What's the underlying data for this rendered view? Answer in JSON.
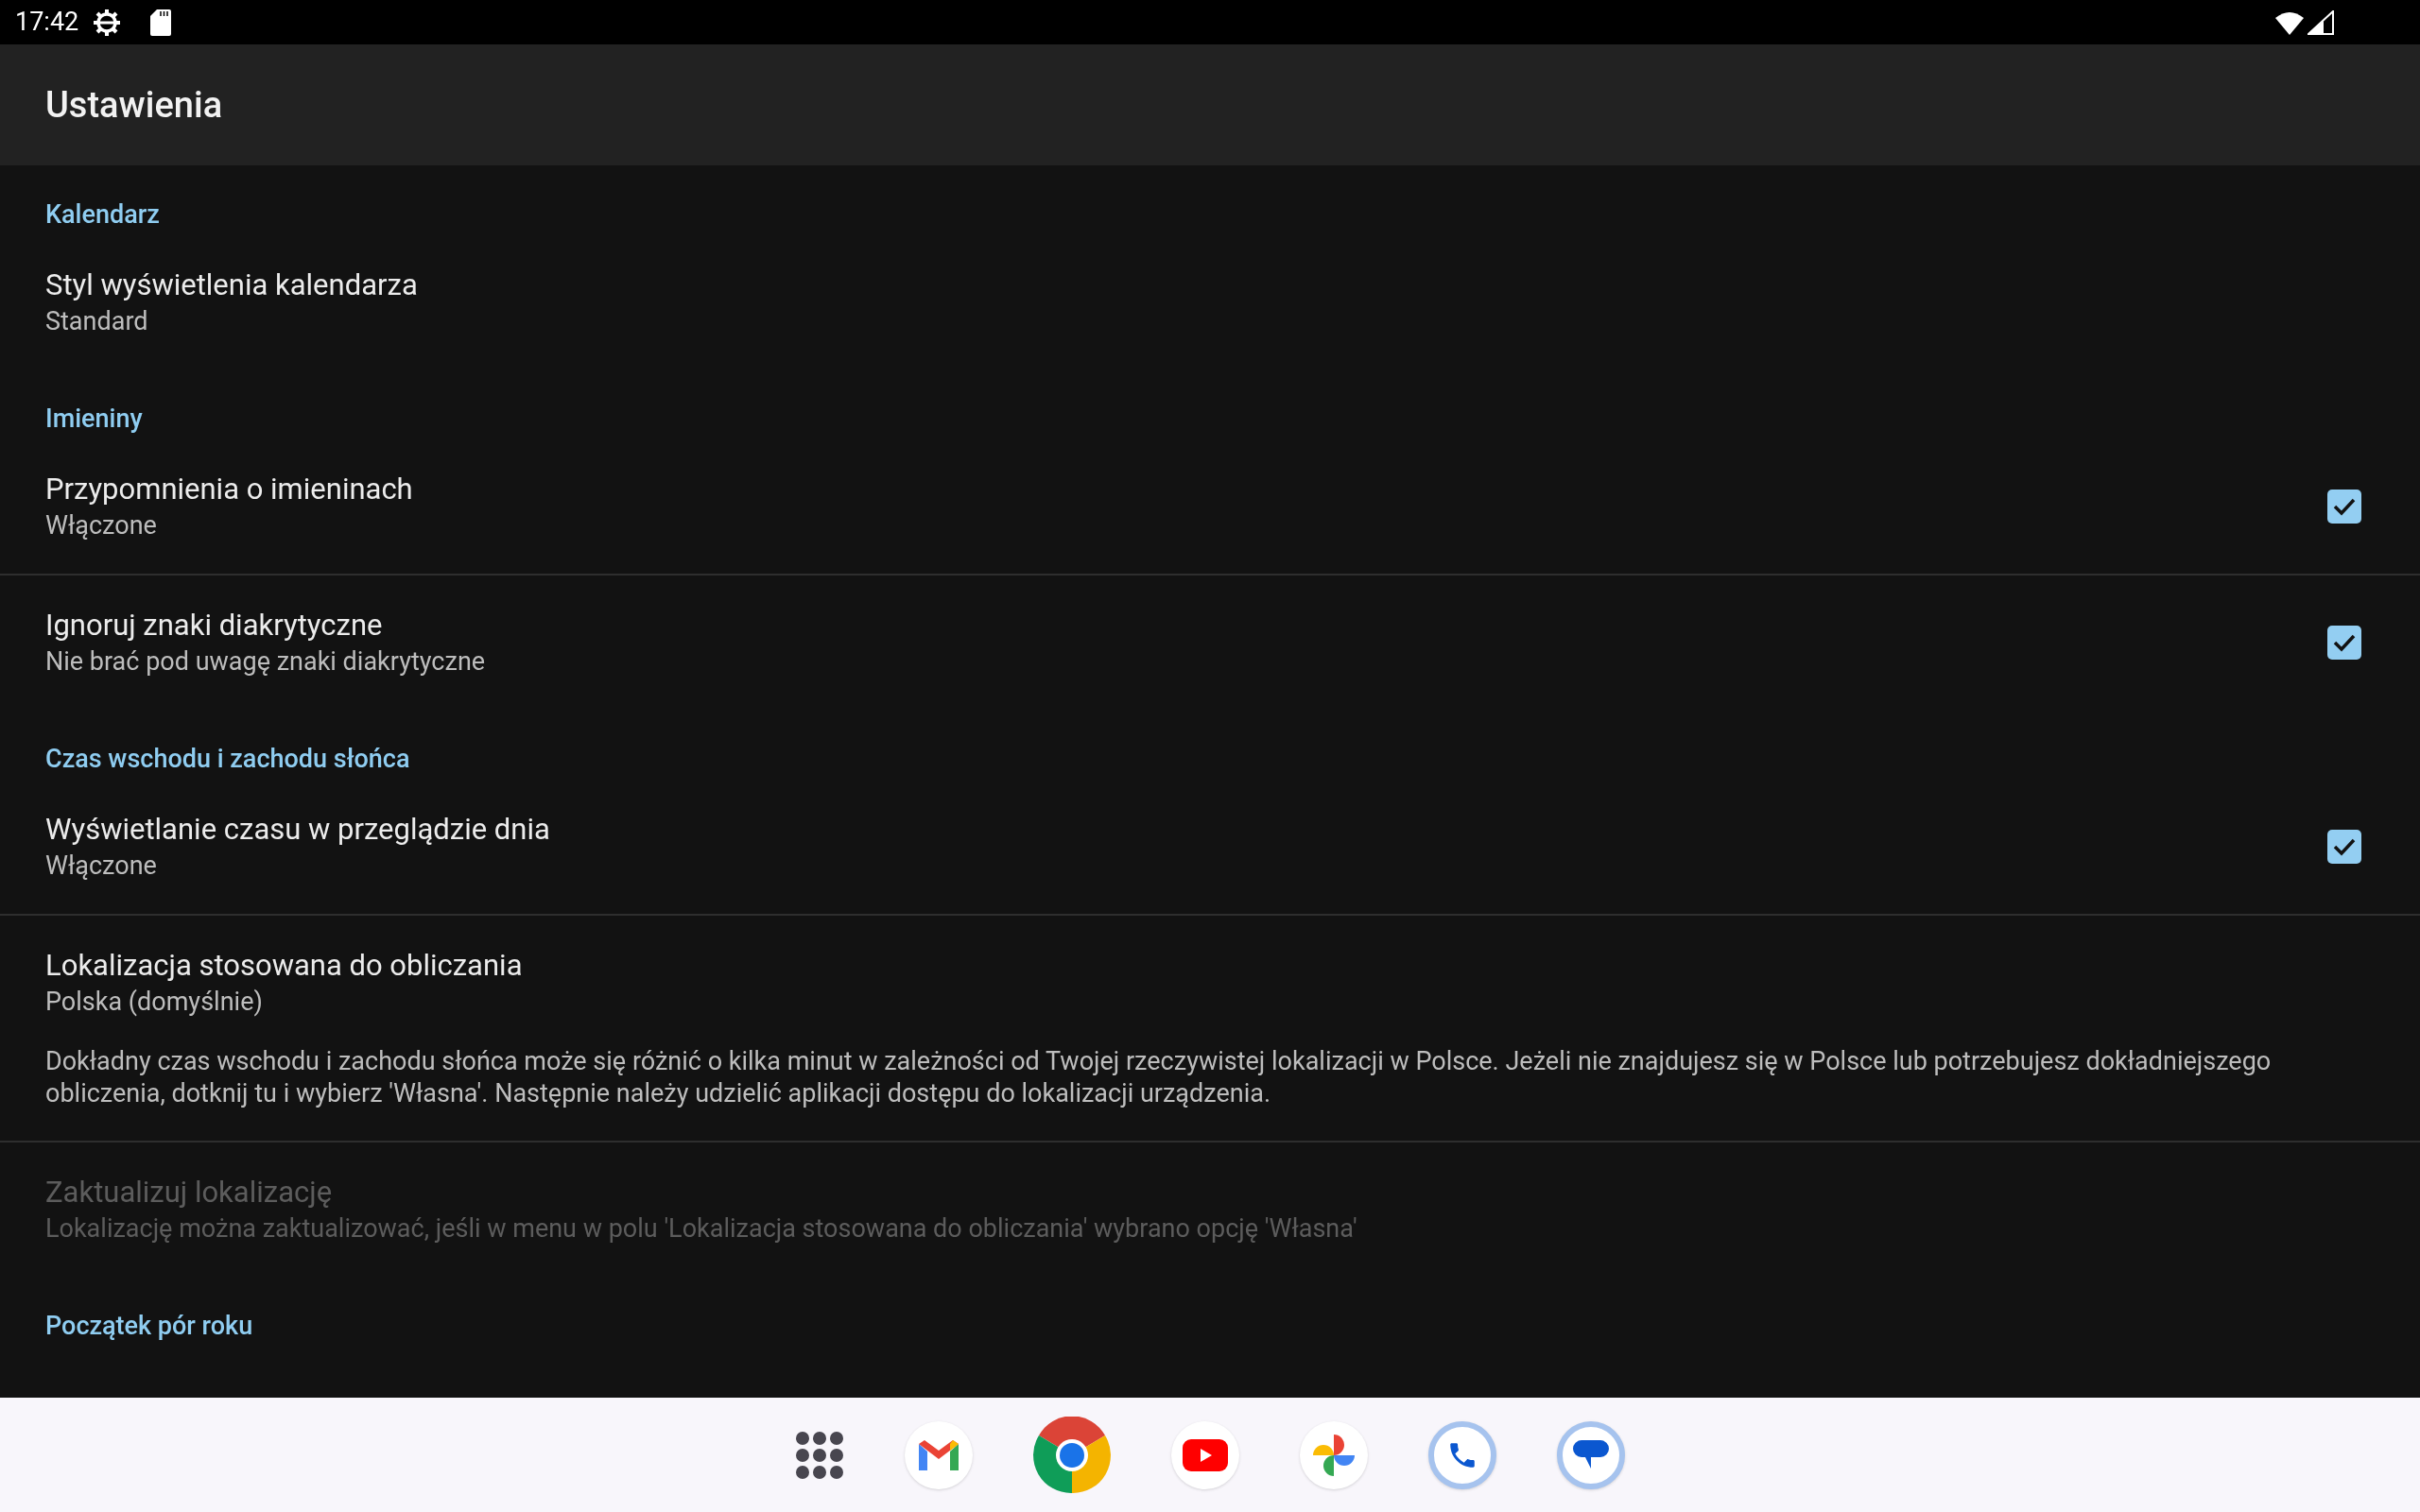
{
  "status_bar": {
    "time": "17:42"
  },
  "app_bar": {
    "title": "Ustawienia"
  },
  "settings": [
    {
      "kind": "category",
      "title": "Kalendarz"
    },
    {
      "kind": "preference",
      "title": "Styl wyświetlenia kalendarza",
      "summary": "Standard",
      "disabled": false,
      "divider": false
    },
    {
      "kind": "category",
      "title": "Imieniny"
    },
    {
      "kind": "checkbox",
      "title": "Przypomnienia o imieninach",
      "summary": "Włączone",
      "checked": true,
      "disabled": false,
      "divider": true
    },
    {
      "kind": "checkbox",
      "title": "Ignoruj znaki diakrytyczne",
      "summary": "Nie brać pod uwagę znaki diakrytyczne",
      "checked": true,
      "disabled": false,
      "divider": false
    },
    {
      "kind": "category",
      "title": "Czas wschodu i zachodu słońca"
    },
    {
      "kind": "checkbox",
      "title": "Wyświetlanie czasu w przeglądzie dnia",
      "summary": "Włączone",
      "checked": true,
      "disabled": false,
      "divider": true
    },
    {
      "kind": "preference",
      "title": "Lokalizacja stosowana do obliczania",
      "summary": "Polska (domyślnie)",
      "description": "Dokładny czas wschodu i zachodu słońca może się różnić o kilka minut w zależności od Twojej rzeczywistej lokalizacji w Polsce. Jeżeli nie znajdujesz się w Polsce lub potrzebujesz dokładniejszego obliczenia, dotknij tu i wybierz 'Własna'. Następnie należy udzielić aplikacji dostępu do lokalizacji urządzenia.",
      "disabled": false,
      "divider": true
    },
    {
      "kind": "preference",
      "title": "Zaktualizuj lokalizację",
      "summary": "Lokalizację można zaktualizować, jeśli w menu w polu 'Lokalizacja stosowana do obliczania' wybrano opcję 'Własna'",
      "disabled": true,
      "divider": false
    },
    {
      "kind": "category",
      "title": "Początek pór roku"
    }
  ]
}
